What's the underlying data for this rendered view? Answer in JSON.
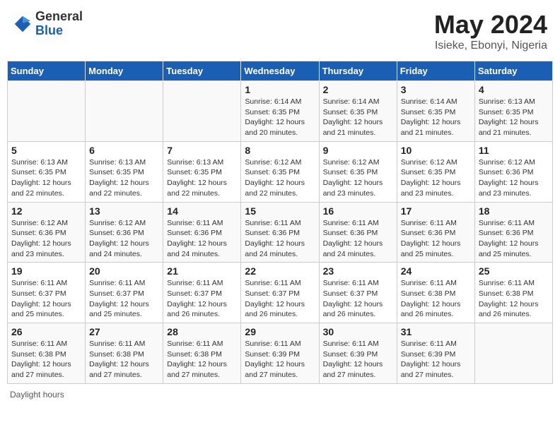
{
  "header": {
    "logo_general": "General",
    "logo_blue": "Blue",
    "month_year": "May 2024",
    "location": "Isieke, Ebonyi, Nigeria"
  },
  "days_of_week": [
    "Sunday",
    "Monday",
    "Tuesday",
    "Wednesday",
    "Thursday",
    "Friday",
    "Saturday"
  ],
  "weeks": [
    [
      {
        "day": "",
        "content": ""
      },
      {
        "day": "",
        "content": ""
      },
      {
        "day": "",
        "content": ""
      },
      {
        "day": "1",
        "content": "Sunrise: 6:14 AM\nSunset: 6:35 PM\nDaylight: 12 hours\nand 20 minutes."
      },
      {
        "day": "2",
        "content": "Sunrise: 6:14 AM\nSunset: 6:35 PM\nDaylight: 12 hours\nand 21 minutes."
      },
      {
        "day": "3",
        "content": "Sunrise: 6:14 AM\nSunset: 6:35 PM\nDaylight: 12 hours\nand 21 minutes."
      },
      {
        "day": "4",
        "content": "Sunrise: 6:13 AM\nSunset: 6:35 PM\nDaylight: 12 hours\nand 21 minutes."
      }
    ],
    [
      {
        "day": "5",
        "content": "Sunrise: 6:13 AM\nSunset: 6:35 PM\nDaylight: 12 hours\nand 22 minutes."
      },
      {
        "day": "6",
        "content": "Sunrise: 6:13 AM\nSunset: 6:35 PM\nDaylight: 12 hours\nand 22 minutes."
      },
      {
        "day": "7",
        "content": "Sunrise: 6:13 AM\nSunset: 6:35 PM\nDaylight: 12 hours\nand 22 minutes."
      },
      {
        "day": "8",
        "content": "Sunrise: 6:12 AM\nSunset: 6:35 PM\nDaylight: 12 hours\nand 22 minutes."
      },
      {
        "day": "9",
        "content": "Sunrise: 6:12 AM\nSunset: 6:35 PM\nDaylight: 12 hours\nand 23 minutes."
      },
      {
        "day": "10",
        "content": "Sunrise: 6:12 AM\nSunset: 6:35 PM\nDaylight: 12 hours\nand 23 minutes."
      },
      {
        "day": "11",
        "content": "Sunrise: 6:12 AM\nSunset: 6:36 PM\nDaylight: 12 hours\nand 23 minutes."
      }
    ],
    [
      {
        "day": "12",
        "content": "Sunrise: 6:12 AM\nSunset: 6:36 PM\nDaylight: 12 hours\nand 23 minutes."
      },
      {
        "day": "13",
        "content": "Sunrise: 6:12 AM\nSunset: 6:36 PM\nDaylight: 12 hours\nand 24 minutes."
      },
      {
        "day": "14",
        "content": "Sunrise: 6:11 AM\nSunset: 6:36 PM\nDaylight: 12 hours\nand 24 minutes."
      },
      {
        "day": "15",
        "content": "Sunrise: 6:11 AM\nSunset: 6:36 PM\nDaylight: 12 hours\nand 24 minutes."
      },
      {
        "day": "16",
        "content": "Sunrise: 6:11 AM\nSunset: 6:36 PM\nDaylight: 12 hours\nand 24 minutes."
      },
      {
        "day": "17",
        "content": "Sunrise: 6:11 AM\nSunset: 6:36 PM\nDaylight: 12 hours\nand 25 minutes."
      },
      {
        "day": "18",
        "content": "Sunrise: 6:11 AM\nSunset: 6:36 PM\nDaylight: 12 hours\nand 25 minutes."
      }
    ],
    [
      {
        "day": "19",
        "content": "Sunrise: 6:11 AM\nSunset: 6:37 PM\nDaylight: 12 hours\nand 25 minutes."
      },
      {
        "day": "20",
        "content": "Sunrise: 6:11 AM\nSunset: 6:37 PM\nDaylight: 12 hours\nand 25 minutes."
      },
      {
        "day": "21",
        "content": "Sunrise: 6:11 AM\nSunset: 6:37 PM\nDaylight: 12 hours\nand 26 minutes."
      },
      {
        "day": "22",
        "content": "Sunrise: 6:11 AM\nSunset: 6:37 PM\nDaylight: 12 hours\nand 26 minutes."
      },
      {
        "day": "23",
        "content": "Sunrise: 6:11 AM\nSunset: 6:37 PM\nDaylight: 12 hours\nand 26 minutes."
      },
      {
        "day": "24",
        "content": "Sunrise: 6:11 AM\nSunset: 6:38 PM\nDaylight: 12 hours\nand 26 minutes."
      },
      {
        "day": "25",
        "content": "Sunrise: 6:11 AM\nSunset: 6:38 PM\nDaylight: 12 hours\nand 26 minutes."
      }
    ],
    [
      {
        "day": "26",
        "content": "Sunrise: 6:11 AM\nSunset: 6:38 PM\nDaylight: 12 hours\nand 27 minutes."
      },
      {
        "day": "27",
        "content": "Sunrise: 6:11 AM\nSunset: 6:38 PM\nDaylight: 12 hours\nand 27 minutes."
      },
      {
        "day": "28",
        "content": "Sunrise: 6:11 AM\nSunset: 6:38 PM\nDaylight: 12 hours\nand 27 minutes."
      },
      {
        "day": "29",
        "content": "Sunrise: 6:11 AM\nSunset: 6:39 PM\nDaylight: 12 hours\nand 27 minutes."
      },
      {
        "day": "30",
        "content": "Sunrise: 6:11 AM\nSunset: 6:39 PM\nDaylight: 12 hours\nand 27 minutes."
      },
      {
        "day": "31",
        "content": "Sunrise: 6:11 AM\nSunset: 6:39 PM\nDaylight: 12 hours\nand 27 minutes."
      },
      {
        "day": "",
        "content": ""
      }
    ]
  ],
  "footer": {
    "daylight_label": "Daylight hours"
  }
}
